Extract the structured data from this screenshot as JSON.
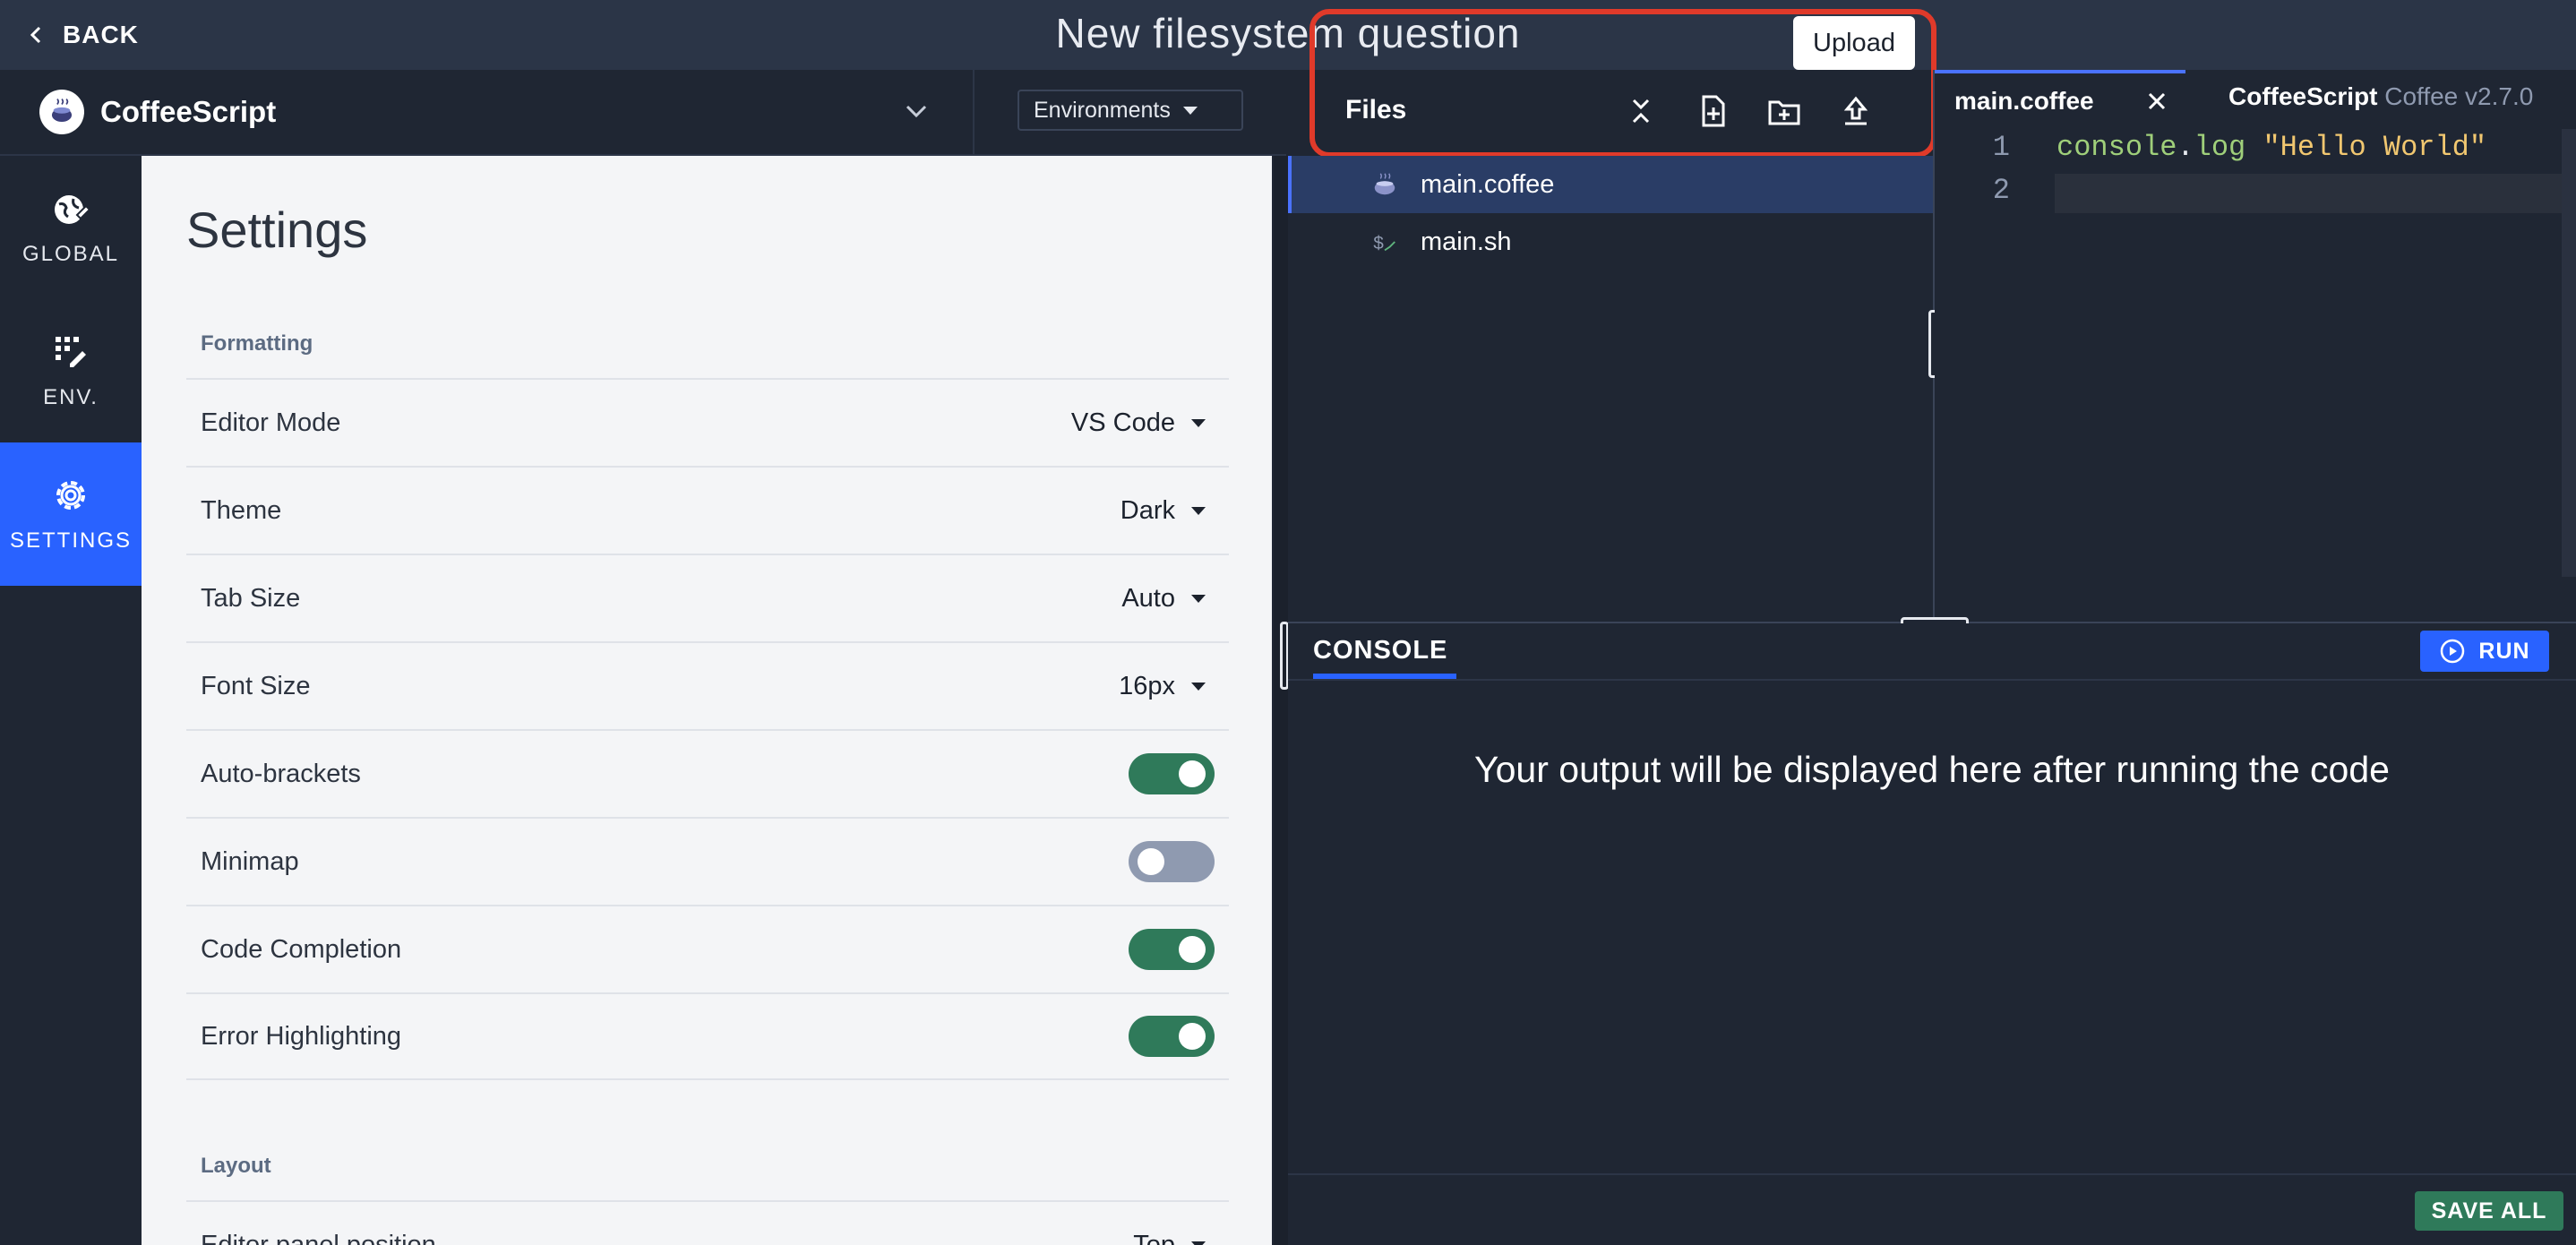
{
  "topbar": {
    "back_label": "BACK",
    "title": "New filesystem question"
  },
  "language": {
    "name": "CoffeeScript",
    "environments_label": "Environments"
  },
  "nav": {
    "items": [
      {
        "label": "GLOBAL",
        "icon": "globe-edit-icon",
        "active": false
      },
      {
        "label": "ENV.",
        "icon": "grid-edit-icon",
        "active": false
      },
      {
        "label": "SETTINGS",
        "icon": "gear-icon",
        "active": true
      }
    ]
  },
  "settings": {
    "title": "Settings",
    "formatting_label": "Formatting",
    "layout_label": "Layout",
    "rows": [
      {
        "label": "Editor Mode",
        "type": "select",
        "value": "VS Code"
      },
      {
        "label": "Theme",
        "type": "select",
        "value": "Dark"
      },
      {
        "label": "Tab Size",
        "type": "select",
        "value": "Auto"
      },
      {
        "label": "Font Size",
        "type": "select",
        "value": "16px"
      },
      {
        "label": "Auto-brackets",
        "type": "toggle",
        "value": true
      },
      {
        "label": "Minimap",
        "type": "toggle",
        "value": false
      },
      {
        "label": "Code Completion",
        "type": "toggle",
        "value": true
      },
      {
        "label": "Error Highlighting",
        "type": "toggle",
        "value": true
      }
    ],
    "layout_rows": [
      {
        "label": "Editor panel position",
        "type": "select",
        "value": "Top"
      }
    ]
  },
  "files": {
    "title": "Files",
    "tooltip": "Upload",
    "list": [
      {
        "name": "main.coffee",
        "icon": "coffee-icon",
        "active": true
      },
      {
        "name": "main.sh",
        "icon": "shell-icon",
        "active": false
      }
    ]
  },
  "editor": {
    "tab_label": "main.coffee",
    "lang_name": "CoffeeScript",
    "lang_version": "Coffee v2.7.0",
    "line_numbers": [
      "1",
      "2"
    ],
    "code": {
      "fn": "console",
      "dot": ".",
      "method": "log",
      "str": "\"Hello World\""
    }
  },
  "console": {
    "tab_label": "CONSOLE",
    "run_label": "RUN",
    "message": "Your output will be displayed here after running the code",
    "save_all_label": "SAVE ALL"
  },
  "colors": {
    "accent": "#2962ff",
    "success": "#2f7a5a",
    "highlight": "#e03a2a"
  }
}
